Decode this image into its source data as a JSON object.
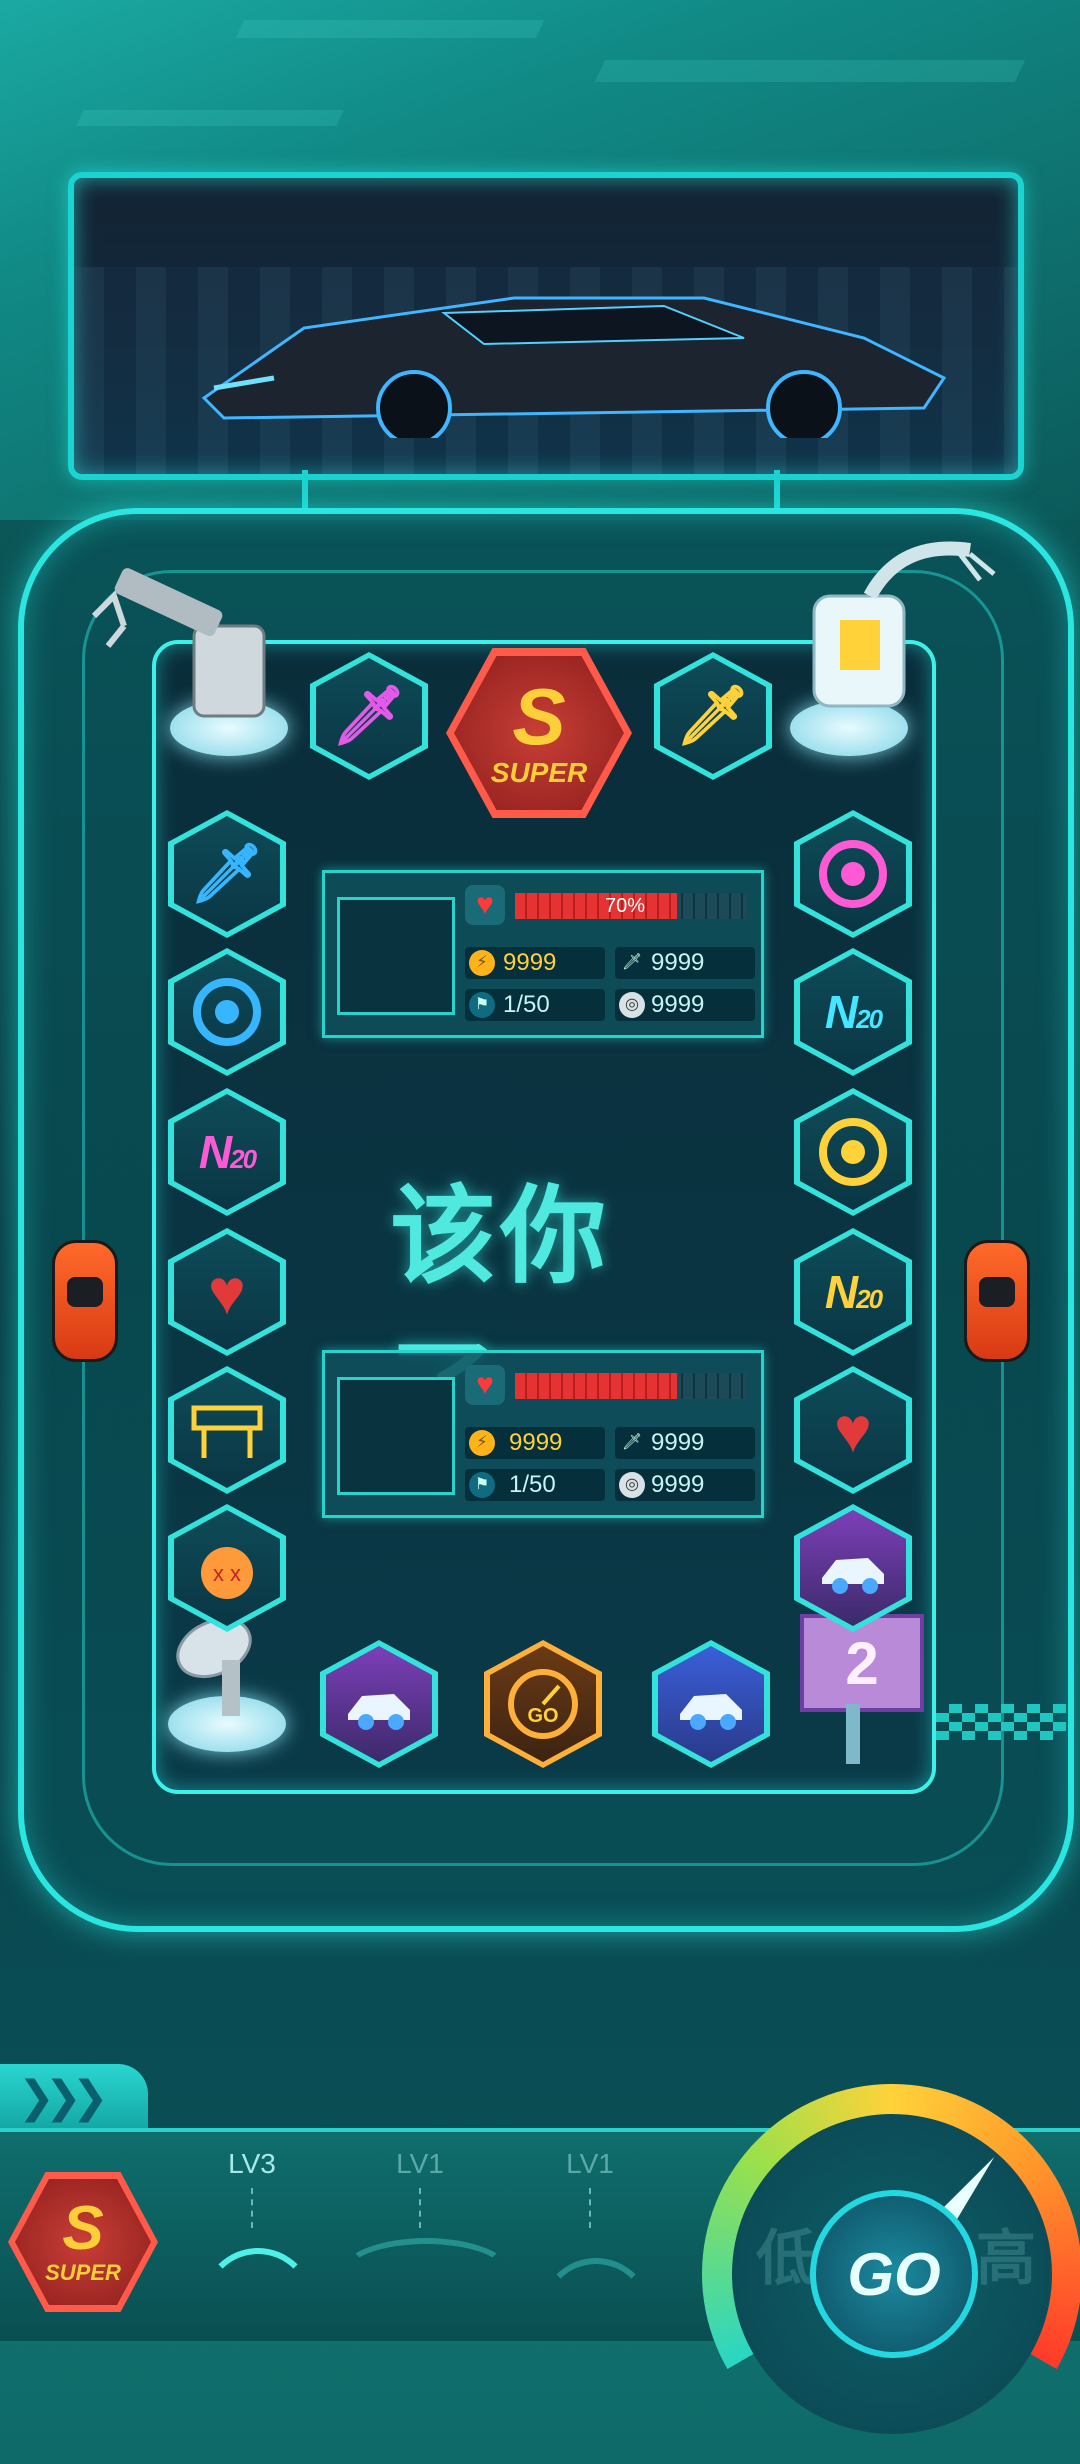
{
  "board": {
    "turn_text": "该你了",
    "dice_value": "2"
  },
  "tiles": {
    "top": [
      {
        "icon": "purple-sword-icon",
        "color": "#e35ae8"
      },
      {
        "icon": "super-badge-icon",
        "label": "SUPER",
        "color": "#ffcf3a"
      },
      {
        "icon": "yellow-sword-icon",
        "color": "#ffd23a"
      }
    ],
    "left": [
      {
        "icon": "blue-sword-icon",
        "color": "#37b6ff"
      },
      {
        "icon": "blue-tire-icon",
        "color": "#37b6ff"
      },
      {
        "icon": "n2o-pink-icon",
        "label_main": "N",
        "label_sub": "20",
        "color": "#ff5ad6"
      },
      {
        "icon": "heart-icon",
        "color": "#e23a3a"
      },
      {
        "icon": "barrier-icon",
        "color": "#ffd23a"
      },
      {
        "icon": "bomb-icon",
        "color": "#ff8a3a"
      }
    ],
    "right": [
      {
        "icon": "pink-tire-icon",
        "color": "#ff5ad6"
      },
      {
        "icon": "n2o-cyan-icon",
        "label_main": "N",
        "label_sub": "20",
        "color": "#45e6ff"
      },
      {
        "icon": "yellow-tire-icon",
        "color": "#ffd23a"
      },
      {
        "icon": "n2o-yellow-icon",
        "label_main": "N",
        "label_sub": "20",
        "color": "#ffd23a"
      },
      {
        "icon": "heart-icon",
        "color": "#e23a3a"
      },
      {
        "icon": "car-upgrade-icon",
        "color": "#c06af0"
      }
    ],
    "bottom": [
      {
        "icon": "car-upgrade-icon",
        "color": "#c06af0"
      },
      {
        "icon": "speedometer-go-icon",
        "label": "GO",
        "color": "#ffb03a"
      },
      {
        "icon": "car-upgrade-blue-icon",
        "color": "#4aa8ff"
      }
    ]
  },
  "player1": {
    "hp_percent": 70,
    "hp_text": "70%",
    "coins": "9999",
    "attack": "9999",
    "laps": "1/50",
    "tires": "9999"
  },
  "player2": {
    "hp_percent": 70,
    "hp_text": "",
    "coins": "9999",
    "attack": "9999",
    "laps": "1/50",
    "tires": "9999"
  },
  "bottom_bar": {
    "super_label": "SUPER",
    "slots": [
      {
        "level": "LV3"
      },
      {
        "level": "LV1"
      },
      {
        "level": "LV1"
      }
    ],
    "go_label": "GO",
    "gauge_left_text": "低",
    "gauge_right_text": "高"
  },
  "colors": {
    "accent": "#2ad2cc",
    "hp": "#e53232",
    "coin": "#ffd23a"
  }
}
